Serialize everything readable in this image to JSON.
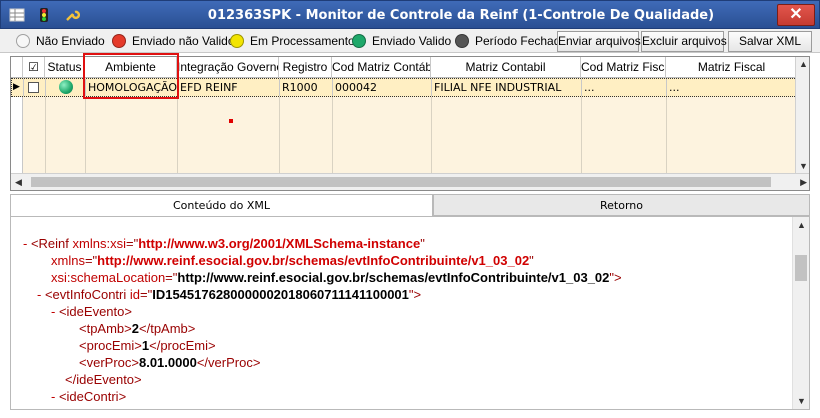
{
  "window": {
    "title": "012363SPK - Monitor de Controle da Reinf (1-Controle De Qualidade)",
    "close": "✕"
  },
  "legend": [
    {
      "label": "Não Enviado",
      "color": "#f4f4f4"
    },
    {
      "label": "Enviado não Valido",
      "color": "#e53a2a"
    },
    {
      "label": "Em Processamento",
      "color": "#f2e400"
    },
    {
      "label": "Enviado Valido",
      "color": "#1ea86a"
    },
    {
      "label": "Período Fechado",
      "color": "#555555"
    }
  ],
  "toolbar": {
    "send": "Enviar arquivos",
    "delete": "Excluir arquivos",
    "save_xml": "Salvar XML"
  },
  "grid": {
    "columns": [
      "☑",
      "Status",
      "Ambiente",
      "Integração Governo",
      "Registro",
      "Cod Matriz Contábil",
      "Matriz Contabil",
      "Cod Matriz Fiscal",
      "Matriz Fiscal"
    ],
    "row": {
      "ambiente": "HOMOLOGAÇÃO",
      "integracao": "EFD REINF",
      "registro": "R1000",
      "cod_matriz_contabil": "000042",
      "matriz_contabil": "FILIAL NFE INDUSTRIAL",
      "cod_matriz_fiscal": "...",
      "matriz_fiscal": "..."
    }
  },
  "tabs": {
    "xml": "Conteúdo do XML",
    "retorno": "Retorno"
  },
  "xml": {
    "l1_tag": "Reinf",
    "l1_attr": "xmlns:xsi",
    "l1_val": "http://www.w3.org/2001/XMLSchema-instance",
    "l2_attr": "xmlns",
    "l2_val": "http://www.reinf.esocial.gov.br/schemas/evtInfoContribuinte/v1_03_02",
    "l3_attr": "xsi:schemaLocation",
    "l3_val": "http://www.reinf.esocial.gov.br/schemas/evtInfoContribuinte/v1_03_02",
    "l4_tag": "evtInfoContri",
    "l4_attr": "id",
    "l4_val": "ID1545176280000002018060711141100001",
    "l5_tag": "ideEvento",
    "tpAmb": "2",
    "procEmi": "1",
    "verProc": "8.01.0000",
    "l10_tag": "ideContri"
  }
}
